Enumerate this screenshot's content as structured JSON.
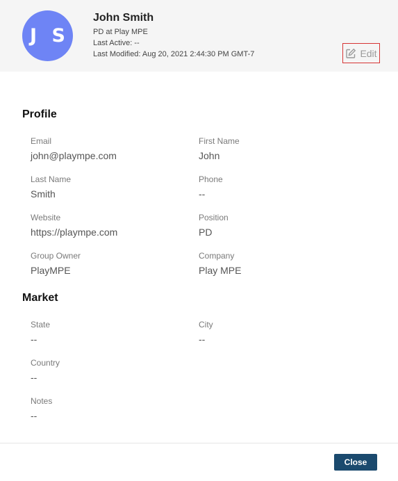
{
  "header": {
    "avatar_initials": "J S",
    "name": "John Smith",
    "subtitle": "PD at Play MPE",
    "last_active": "Last Active: --",
    "last_modified": "Last Modified: Aug 20, 2021 2:44:30 PM GMT-7",
    "edit_label": "Edit",
    "avatar_color": "#6e84f5"
  },
  "profile": {
    "title": "Profile",
    "fields": [
      {
        "label": "Email",
        "value": "john@plaympe.com"
      },
      {
        "label": "First Name",
        "value": "John"
      },
      {
        "label": "Last Name",
        "value": "Smith"
      },
      {
        "label": "Phone",
        "value": "--"
      },
      {
        "label": "Website",
        "value": "https://plaympe.com"
      },
      {
        "label": "Position",
        "value": "PD"
      },
      {
        "label": "Group Owner",
        "value": "PlayMPE"
      },
      {
        "label": "Company",
        "value": "Play MPE"
      }
    ]
  },
  "market": {
    "title": "Market",
    "fields": [
      {
        "label": "State",
        "value": "--"
      },
      {
        "label": "City",
        "value": "--"
      },
      {
        "label": "Country",
        "value": "--"
      },
      {
        "label": "Notes",
        "value": "--"
      }
    ]
  },
  "footer": {
    "close_label": "Close",
    "close_color": "#1b4a6e"
  }
}
